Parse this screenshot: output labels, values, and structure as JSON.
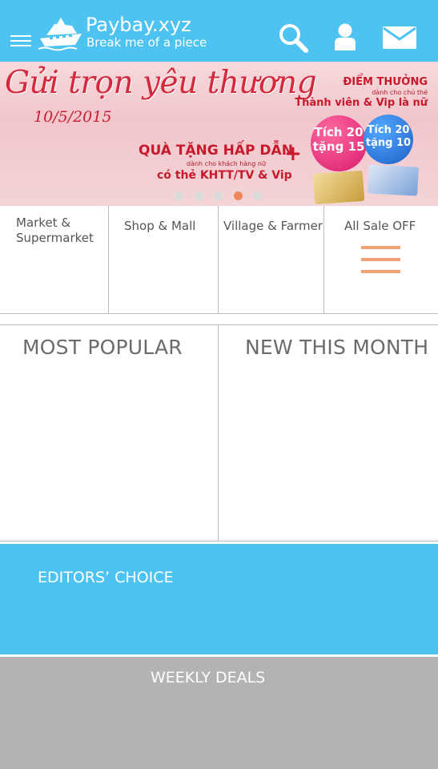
{
  "header": {
    "title": "Paybay.xyz",
    "subtitle": "Break me of a piece",
    "icons": [
      "menu-icon",
      "ship-logo-icon",
      "search-icon",
      "user-icon",
      "mail-icon"
    ],
    "background": "#4ec3f2"
  },
  "banner": {
    "script_text": "Gửi trọn yêu thương",
    "date": "10/5/2015",
    "gift_title": "QUÀ TẶNG HẤP DẪN",
    "gift_sub": "dành cho khách hàng nữ",
    "gift_cards": "có thẻ KHTT/TV & Vip",
    "points_title": "ĐIỂM THƯỞNG",
    "points_sub": "dành cho chủ thẻ",
    "points_members": "Thành viên & Vip là nữ",
    "bubble_pink": [
      "Tích 20",
      "tặng 15"
    ],
    "bubble_blue": [
      "Tích 20",
      "tặng 10"
    ],
    "dot_count": 5,
    "active_dot": 3
  },
  "categories": [
    {
      "label_1": "Market &",
      "label_2": "Supermarket"
    },
    {
      "label_1": "Shop & Mall"
    },
    {
      "label_1": "Village & Farmer"
    },
    {
      "label_1": "All Sale OFF",
      "icon": "list-icon"
    }
  ],
  "sections": {
    "most_popular": "MOST POPULAR",
    "new_this_month": "NEW THIS MONTH",
    "editors_choice": "EDITORS’ CHOICE",
    "weekly_deals": "WEEKLY DEALS"
  },
  "colors": {
    "accent": "#4ec3f2",
    "sale_icon": "#f0a074",
    "active_dot": "#f0875a",
    "weekly_bg": "#b3b3b3"
  }
}
